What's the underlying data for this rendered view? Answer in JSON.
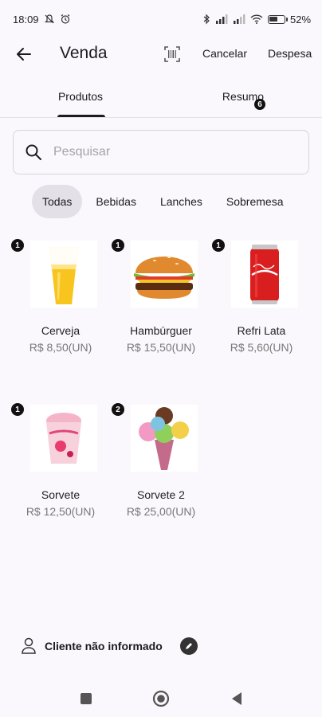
{
  "status_bar": {
    "time": "18:09",
    "battery": "52",
    "battery_unit": "%",
    "icons": [
      "mute-icon",
      "alarm-icon",
      "bluetooth-icon",
      "signal-icon",
      "signal-icon",
      "wifi-icon",
      "battery-icon"
    ]
  },
  "app_bar": {
    "title": "Venda",
    "cancel_label": "Cancelar",
    "expense_label": "Despesa"
  },
  "tabs": {
    "products_label": "Produtos",
    "summary_label": "Resumo",
    "summary_badge": "6",
    "active": "products"
  },
  "search": {
    "placeholder": "Pesquisar",
    "value": ""
  },
  "categories": [
    "Todas",
    "Bebidas",
    "Lanches",
    "Sobremesa"
  ],
  "selected_category": "Todas",
  "products": [
    {
      "name": "Cerveja",
      "price": "R$ 8,50(UN)",
      "qty": "1",
      "image": "beer-glass-image"
    },
    {
      "name": "Hambúrguer",
      "price": "R$ 15,50(UN)",
      "qty": "1",
      "image": "burger-image"
    },
    {
      "name": "Refri Lata",
      "price": "R$ 5,60(UN)",
      "qty": "1",
      "image": "soda-can-image"
    },
    {
      "name": "Sorvete",
      "price": "R$ 12,50(UN)",
      "qty": "1",
      "image": "ice-cream-cup-image"
    },
    {
      "name": "Sorvete 2",
      "price": "R$ 25,00(UN)",
      "qty": "2",
      "image": "ice-cream-scoops-image"
    }
  ],
  "client": {
    "label": "Cliente não informado"
  },
  "colors": {
    "background": "#fbf8fd",
    "accent": "#1c1b1f",
    "chip_active": "#e3e0e8",
    "badge": "#111111"
  }
}
